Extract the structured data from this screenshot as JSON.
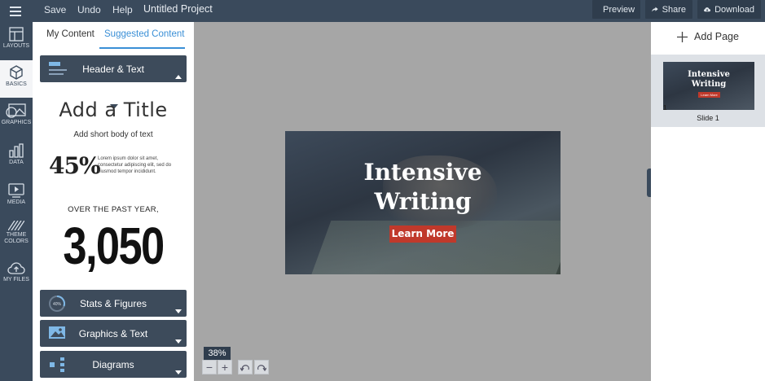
{
  "topbar": {
    "menu": [
      "Save",
      "Undo",
      "Help"
    ],
    "project_title": "Untitled Project",
    "preview_label": "Preview",
    "share_label": "Share",
    "download_label": "Download"
  },
  "rail": {
    "items": [
      {
        "label": "LAYOUTS",
        "icon": "layouts-icon"
      },
      {
        "label": "BASICS",
        "icon": "cube-icon"
      },
      {
        "label": "GRAPHICS",
        "icon": "graphics-icon"
      },
      {
        "label": "DATA",
        "icon": "bar-chart-icon"
      },
      {
        "label": "MEDIA",
        "icon": "play-icon"
      },
      {
        "label": "THEME COLORS",
        "icon": "stripes-icon"
      },
      {
        "label": "MY FILES",
        "icon": "cloud-upload-icon"
      }
    ],
    "active_index": 1
  },
  "panel": {
    "tabs": [
      "My Content",
      "Suggested Content"
    ],
    "active_tab": 1,
    "sections": {
      "header_text": "Header & Text",
      "stats": "Stats & Figures",
      "graphics": "Graphics & Text",
      "diagrams": "Diagrams"
    },
    "stats_icon_label": "40%",
    "preview": {
      "title": "Add a Title",
      "body": "Add short body of text",
      "percent": "45%",
      "lorem": "Lorem ipsum dolor sit amet, consectetur adipiscing elit, sed do eiusmod tempor incididunt.",
      "caption": "OVER THE PAST YEAR,",
      "big_number": "3,050"
    }
  },
  "slide": {
    "title_line1": "Intensive",
    "title_line2": "Writing",
    "button": "Learn More",
    "accent": "#c0392b"
  },
  "zoom": {
    "level": "38%",
    "minus": "−",
    "plus": "+"
  },
  "right_panel": {
    "add_page_label": "Add Page",
    "slides": [
      {
        "number": "1",
        "label": "Slide 1"
      }
    ]
  },
  "colors": {
    "chrome": "#3a4a5c",
    "accent_blue": "#3a8fd6",
    "canvas_bg": "#a6a6a6"
  }
}
